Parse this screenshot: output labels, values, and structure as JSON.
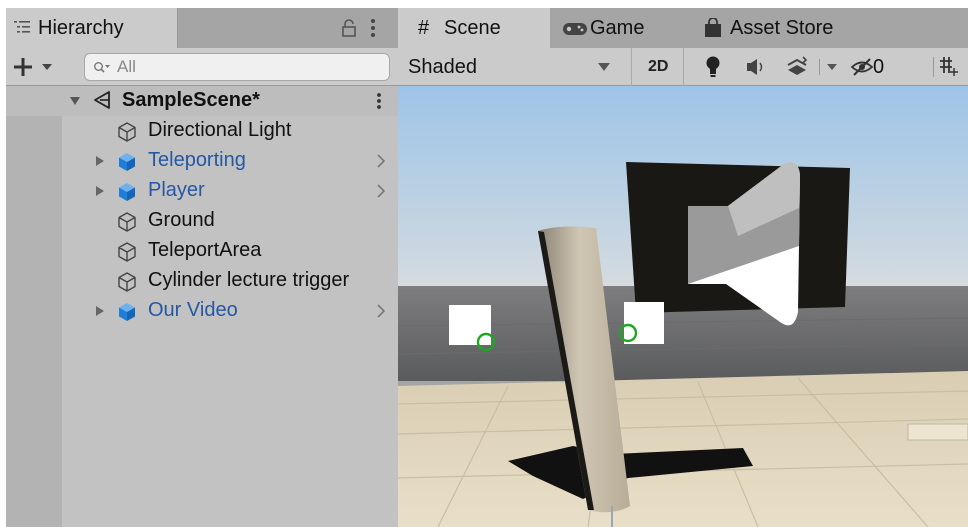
{
  "hierarchy": {
    "tab_label": "Hierarchy",
    "search_placeholder": "All",
    "scene_name": "SampleScene*",
    "items": [
      {
        "label": "Directional Light",
        "type": "object"
      },
      {
        "label": "Teleporting",
        "type": "prefab",
        "expandable": true
      },
      {
        "label": "Player",
        "type": "prefab",
        "expandable": true
      },
      {
        "label": "Ground",
        "type": "object"
      },
      {
        "label": "TeleportArea",
        "type": "object"
      },
      {
        "label": "Cylinder lecture trigger",
        "type": "object"
      },
      {
        "label": "Our Video",
        "type": "prefab",
        "expandable": true
      }
    ]
  },
  "scene_view": {
    "tabs": [
      {
        "label": "Scene",
        "icon": "grid-hash-icon",
        "active": true
      },
      {
        "label": "Game",
        "icon": "gamepad-icon",
        "active": false
      },
      {
        "label": "Asset Store",
        "icon": "shopping-bag-icon",
        "active": false
      }
    ],
    "toolbar": {
      "shading_mode": "Shaded",
      "mode_2d_label": "2D",
      "hidden_objects_count": "0"
    }
  },
  "colors": {
    "prefab_blue": "#2657a6",
    "panel_bg": "#c2c2c2",
    "toolbar_bg": "#cbcbcb",
    "gizmo_green": "#1fa81f"
  }
}
